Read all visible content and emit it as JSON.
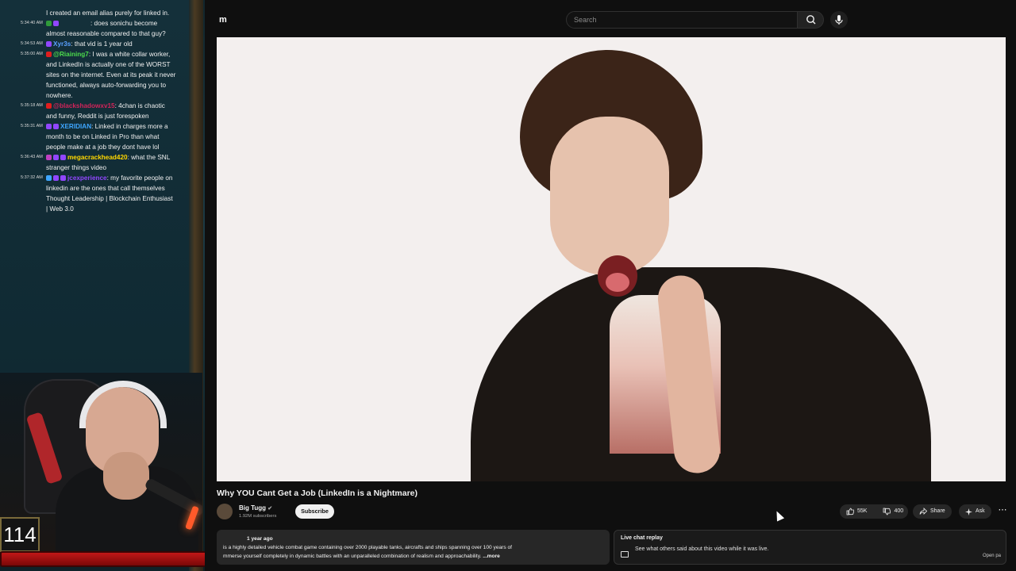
{
  "chat": {
    "messages": [
      {
        "time": "",
        "user": "",
        "user_color": "#ffffff",
        "badges": [],
        "text": "I created an email alias purely for linked in."
      },
      {
        "time": "5:34:40 AM",
        "user": "",
        "user_color": "#ffffff",
        "badges": [
          "#2f9a3a",
          "#9146ff"
        ],
        "text": ": does sonichu become almost reasonable compared to that guy?"
      },
      {
        "time": "5:34:53 AM",
        "user": "Xyr3s",
        "user_color": "#5aa0ff",
        "badges": [
          "#9146ff"
        ],
        "text": ": that vid is 1 year old"
      },
      {
        "time": "5:35:00 AM",
        "user": "@Riaining7",
        "user_color": "#4ddc4d",
        "badges": [
          "#e01e1e"
        ],
        "text": ": I was a white collar worker, and LinkedIn is actually one of the WORST sites on the internet. Even at its peak it never functioned, always auto-forwarding you to nowhere."
      },
      {
        "time": "5:35:18 AM",
        "user": "@blackshadowxv15",
        "user_color": "#d2245a",
        "badges": [
          "#e01e1e"
        ],
        "text": ": 4chan is chaotic and funny, Reddit is just forespoken"
      },
      {
        "time": "5:35:31 AM",
        "user": "XERIDIAN",
        "user_color": "#3ea6ff",
        "badges": [
          "#9146ff",
          "#9146ff"
        ],
        "text": ": Linked in charges more a month to be on Linked in Pro than what people make at a job they dont have lol"
      },
      {
        "time": "5:36:43 AM",
        "user": "megacrackhead420",
        "user_color": "#ffd700",
        "badges": [
          "#c040c0",
          "#9146ff",
          "#9146ff"
        ],
        "text": ": what the SNL stranger things video"
      },
      {
        "time": "5:37:32 AM",
        "user": "jcexperience",
        "user_color": "#9146ff",
        "badges": [
          "#3ea6ff",
          "#9146ff",
          "#9146ff"
        ],
        "text": ": my favorite people on linkedin are the ones that call themselves Thought Leadership | Blockchain Enthusiast | Web 3.0"
      }
    ]
  },
  "overlay": {
    "counter": "114"
  },
  "youtube": {
    "logo_text": "m",
    "search_placeholder": "Search",
    "video_title": "Why YOU Cant Get a Job (LinkedIn is a Nightmare)",
    "channel_name": "Big Tugg",
    "channel_subs": "1.92M subscribers",
    "subscribe_label": "Subscribe",
    "likes": "55K",
    "dislikes": "400",
    "share_label": "Share",
    "ask_label": "Ask",
    "description_date": "1 year ago",
    "description_line1": "is a highly detailed vehicle combat game containing over 2000 playable tanks, aircrafts and ships spanning over 100 years of",
    "description_line2": "mmerse yourself completely in dynamic battles with an unparalleled combination of realism and approachability.",
    "description_more": "...more",
    "live_chat_title": "Live chat replay",
    "live_chat_sub": "See what others said about this video while it was live.",
    "live_chat_open": "Open pa"
  },
  "colors": {
    "yt_bg": "#0f0f0f",
    "chat_bg": "#14303a",
    "red_bar": "#c11818"
  }
}
